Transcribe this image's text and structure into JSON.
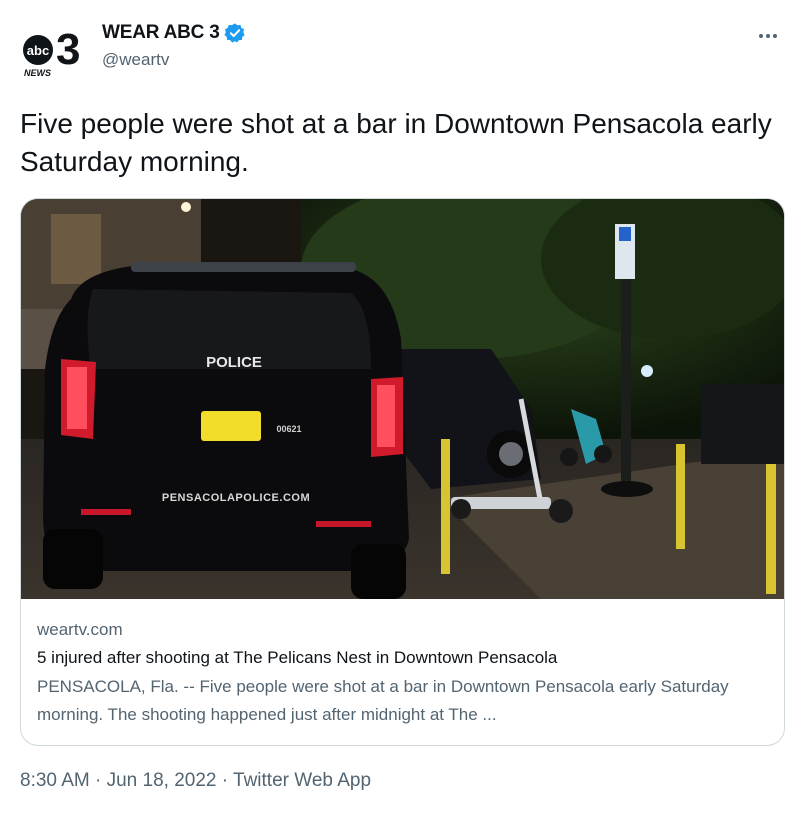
{
  "author": {
    "display_name": "WEAR ABC 3",
    "handle": "@weartv",
    "verified": true,
    "avatar_logo": {
      "brand": "abc",
      "number": "3",
      "sub": "NEWS"
    }
  },
  "tweet": {
    "text": "Five people were shot at a bar in Downtown Pensacola early Saturday morning."
  },
  "card": {
    "domain": "weartv.com",
    "title": "5 injured after shooting at The Pelicans Nest in Downtown Pensacola",
    "description": "PENSACOLA, Fla. -- Five people were shot at a bar in Downtown Pensacola early Saturday morning. The shooting happened just after midnight at The ...",
    "image_text": {
      "police": "POLICE",
      "website": "PENSACOLAPOLICE.COM",
      "unit": "00621"
    }
  },
  "meta": {
    "time": "8:30 AM",
    "sep1": " · ",
    "date": "Jun 18, 2022",
    "sep2": " · ",
    "source": "Twitter Web App"
  },
  "icons": {
    "more": "more-horizontal-icon",
    "verified": "verified-badge-icon"
  },
  "colors": {
    "verified_blue": "#1d9bf0",
    "secondary_text": "#536471",
    "border": "#cfd9de"
  }
}
